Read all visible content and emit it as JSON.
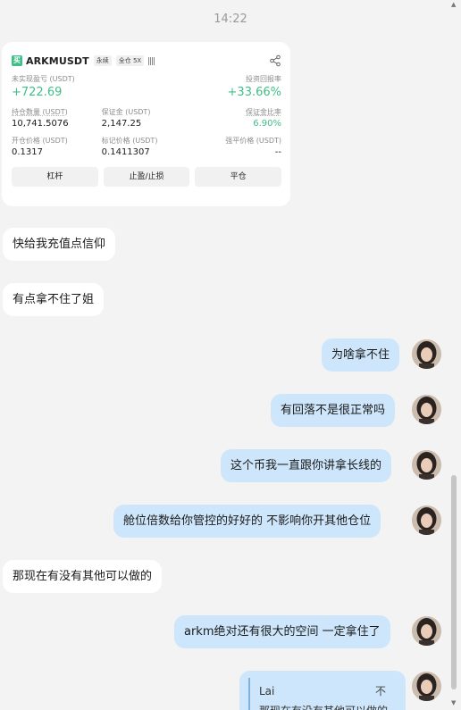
{
  "time": "14:22",
  "trade_card": {
    "coin_icon_char": "买",
    "symbol": "ARKMUSDT",
    "tags": [
      "永续",
      "全仓 5X"
    ],
    "unrealized_label": "未实现盈亏 (USDT)",
    "unrealized_value": "+722.69",
    "roi_label": "投资回报率",
    "roi_value": "+33.66%",
    "position_qty_label": "持仓数量 (USDT)",
    "position_qty_value": "10,741.5076",
    "margin_label": "保证金 (USDT)",
    "margin_value": "2,147.25",
    "margin_ratio_label": "保证金比率",
    "margin_ratio_value": "6.90%",
    "entry_price_label": "开仓价格 (USDT)",
    "entry_price_value": "0.1317",
    "mark_price_label": "标记价格 (USDT)",
    "mark_price_value": "0.1411307",
    "liq_price_label": "强平价格 (USDT)",
    "liq_price_value": "--",
    "buttons": {
      "leverage": "杠杆",
      "tp_sl": "止盈/止损",
      "close": "平仓"
    }
  },
  "messages": [
    {
      "dir": "in",
      "text": "快给我充值点信仰"
    },
    {
      "dir": "in",
      "text": "有点拿不住了姐"
    },
    {
      "dir": "out",
      "text": "为啥拿不住"
    },
    {
      "dir": "out",
      "text": "有回落不是很正常吗"
    },
    {
      "dir": "out",
      "text": "这个币我一直跟你讲拿长线的"
    },
    {
      "dir": "out",
      "text": "舱位倍数给你管控的好好的  不影响你开其他仓位"
    },
    {
      "dir": "in",
      "text": "那现在有没有其他可以做的"
    },
    {
      "dir": "out",
      "text": "arkm绝对还有很大的空间 一定拿住了"
    }
  ],
  "quote": {
    "name": "Lai",
    "pin_icon": "不",
    "snippet": "那现在有没有其他可以做的"
  }
}
